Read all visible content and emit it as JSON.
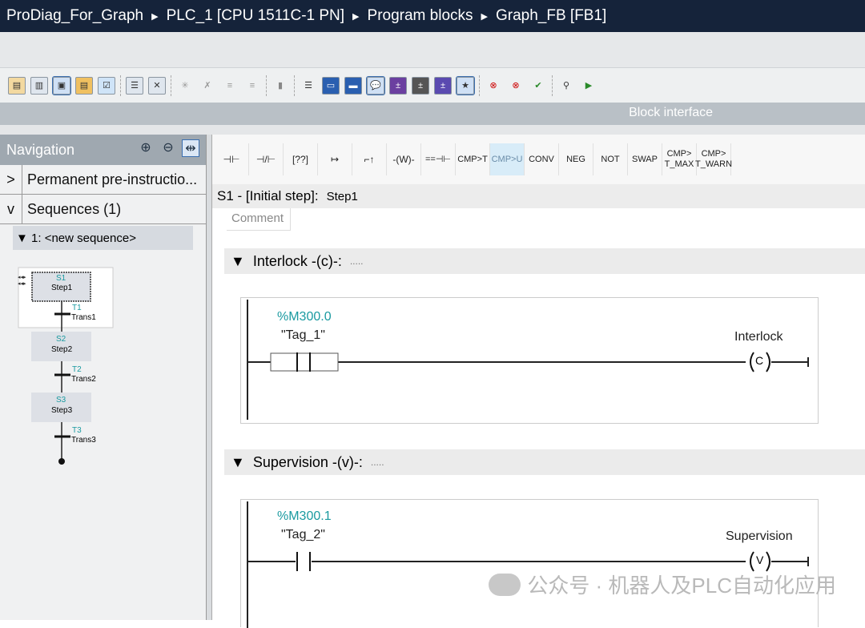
{
  "breadcrumb": [
    "ProDiag_For_Graph",
    "PLC_1 [CPU 1511C-1 PN]",
    "Program blocks",
    "Graph_FB [FB1]"
  ],
  "block_interface": "Block interface",
  "navigation": {
    "title": "Navigation",
    "items": [
      {
        "chevron": ">",
        "label": "Permanent pre-instructio..."
      },
      {
        "chevron": "v",
        "label": "Sequences (1)"
      }
    ],
    "sequence": "▼ 1: <new sequence>",
    "steps": [
      {
        "id": "S1",
        "name": "Step1"
      },
      {
        "id": "S2",
        "name": "Step2"
      },
      {
        "id": "S3",
        "name": "Step3"
      }
    ],
    "transitions": [
      {
        "id": "T1",
        "name": "Trans1"
      },
      {
        "id": "T2",
        "name": "Trans2"
      },
      {
        "id": "T3",
        "name": "Trans3"
      }
    ]
  },
  "palette": [
    "⊣⊢",
    "⊣/⊢",
    "[??]",
    "↦",
    "⌐↑",
    "-(W)-",
    "==⊣⊢",
    "CMP>T",
    "CMP>U",
    "CONV",
    "NEG",
    "NOT",
    "SWAP",
    "CMP> T_MAX",
    "CMP> T_WARN"
  ],
  "step_header": {
    "title": "S1 - [Initial step]:",
    "name": "Step1"
  },
  "comment": "Comment",
  "interlock": {
    "title": "Interlock -(c)-:",
    "dots": ".....",
    "address": "%M300.0",
    "tag": "\"Tag_1\"",
    "coil_label": "Interlock",
    "coil": "C"
  },
  "supervision": {
    "title": "Supervision -(v)-:",
    "dots": ".....",
    "address": "%M300.1",
    "tag": "\"Tag_2\"",
    "coil_label": "Supervision",
    "coil": "V"
  },
  "watermark": "公众号 · 机器人及PLC自动化应用"
}
